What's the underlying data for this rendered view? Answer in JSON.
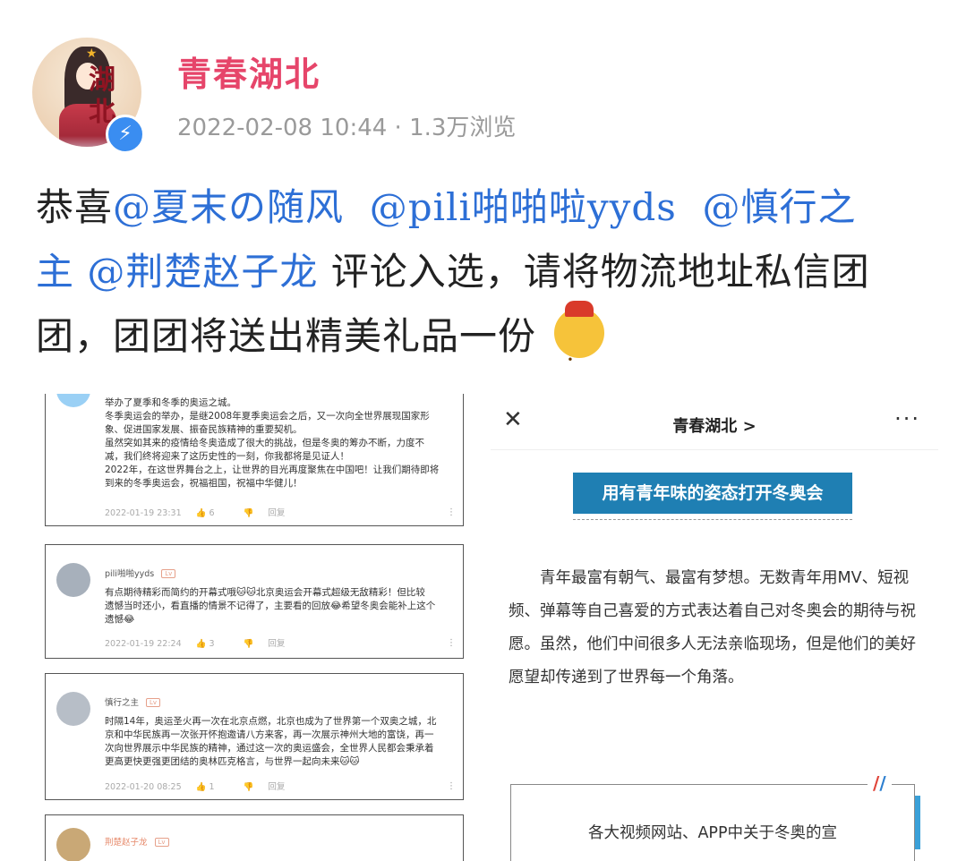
{
  "header": {
    "author": "青春湖北",
    "meta": "2022-02-08 10:44 · 1.3万浏览",
    "avatar_glyph_top": "湖",
    "avatar_glyph_bottom": "北"
  },
  "post": {
    "prefix": "恭喜",
    "mentions": [
      "@夏末の随风",
      "@pili啪啪啦yyds",
      "@慎行之主",
      "@荆楚赵子龙"
    ],
    "text": "评论入选，请将物流地址私信团团，团团将送出精美礼品一份"
  },
  "left_screenshot": {
    "card1": {
      "lines": [
        "举办了夏季和冬季的奥运之城。",
        "冬季奥运会的举办，是继2008年夏季奥运会之后，又一次向全世界展现国家形",
        "象、促进国家发展、振奋民族精神的重要契机。",
        "虽然突如其来的疫情给冬奥造成了很大的挑战，但是冬奥的筹办不断，力度不",
        "减，我们终将迎来了这历史性的一刻，你我都将是见证人！",
        "2022年，在这世界舞台之上，让世界的目光再度聚焦在中国吧！让我们期待即将",
        "到来的冬季奥运会，祝福祖国，祝福中华健儿！"
      ],
      "date": "2022-01-19 23:31",
      "likes": "6",
      "reply": "回复"
    },
    "card2": {
      "user": "pili啪啪yyds",
      "lines": [
        "有点期待精彩而简约的开幕式哦🐱🐱北京奥运会开幕式超级无敌精彩！但比较",
        "遗憾当时还小，看直播的情景不记得了，主要看的回放😂希望冬奥会能补上这个",
        "遗憾😂"
      ],
      "date": "2022-01-19 22:24",
      "likes": "3",
      "reply": "回复"
    },
    "card3": {
      "user": "慎行之主",
      "lines": [
        "时隔14年，奥运圣火再一次在北京点燃，北京也成为了世界第一个双奥之城，北",
        "京和中华民族再一次张开怀抱邀请八方来客，再一次展示神州大地的富饶，再一",
        "次向世界展示中华民族的精神，通过这一次的奥运盛会，全世界人民都会秉承着",
        "更高更快更强更团结的奥林匹克格言，与世界一起向未来🐱🐱"
      ],
      "date": "2022-01-20 08:25",
      "likes": "1",
      "reply": "回复"
    },
    "card4": {
      "user": "荆楚赵子龙"
    }
  },
  "right_screenshot": {
    "nav_title": "青春湖北 >",
    "banner": "用有青年味的姿态打开冬奥会",
    "body": "青年最富有朝气、最富有梦想。无数青年用MV、短视频、弹幕等自己喜爱的方式表达着自己对冬奥会的期待与祝愿。虽然，他们中间很多人无法亲临现场，但是他们的美好愿望却传递到了世界每一个角落。",
    "box_text": "各大视频网站、APP中关于冬奥的宣"
  }
}
